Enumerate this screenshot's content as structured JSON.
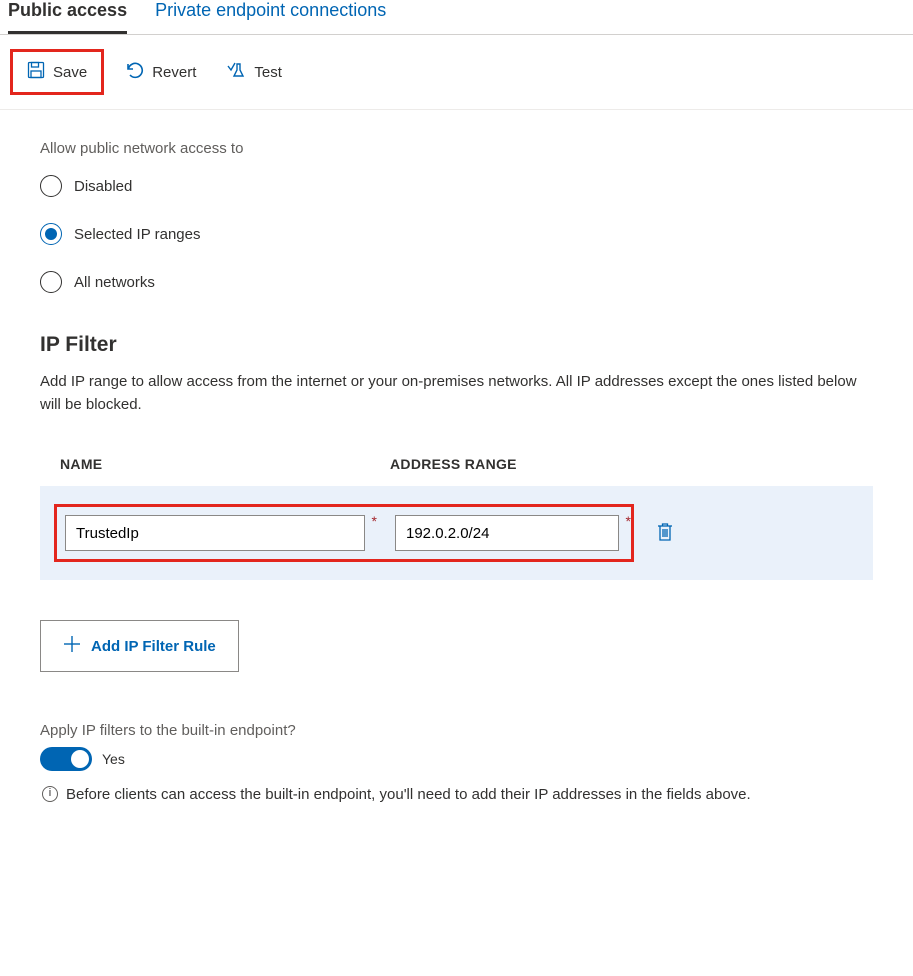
{
  "tabs": {
    "public": "Public access",
    "private": "Private endpoint connections"
  },
  "toolbar": {
    "save": "Save",
    "revert": "Revert",
    "test": "Test"
  },
  "access": {
    "label": "Allow public network access to",
    "options": {
      "disabled": "Disabled",
      "selected_ip": "Selected IP ranges",
      "all": "All networks"
    }
  },
  "ipfilter": {
    "title": "IP Filter",
    "desc": "Add IP range to allow access from the internet or your on-premises networks. All IP addresses except the ones listed below will be blocked.",
    "headers": {
      "name": "NAME",
      "range": "ADDRESS RANGE"
    },
    "rows": [
      {
        "name": "TrustedIp",
        "range": "192.0.2.0/24"
      }
    ],
    "add_btn": "Add IP Filter Rule"
  },
  "builtin": {
    "label": "Apply IP filters to the built-in endpoint?",
    "value": "Yes",
    "note": "Before clients can access the built-in endpoint, you'll need to add their IP addresses in the fields above."
  }
}
